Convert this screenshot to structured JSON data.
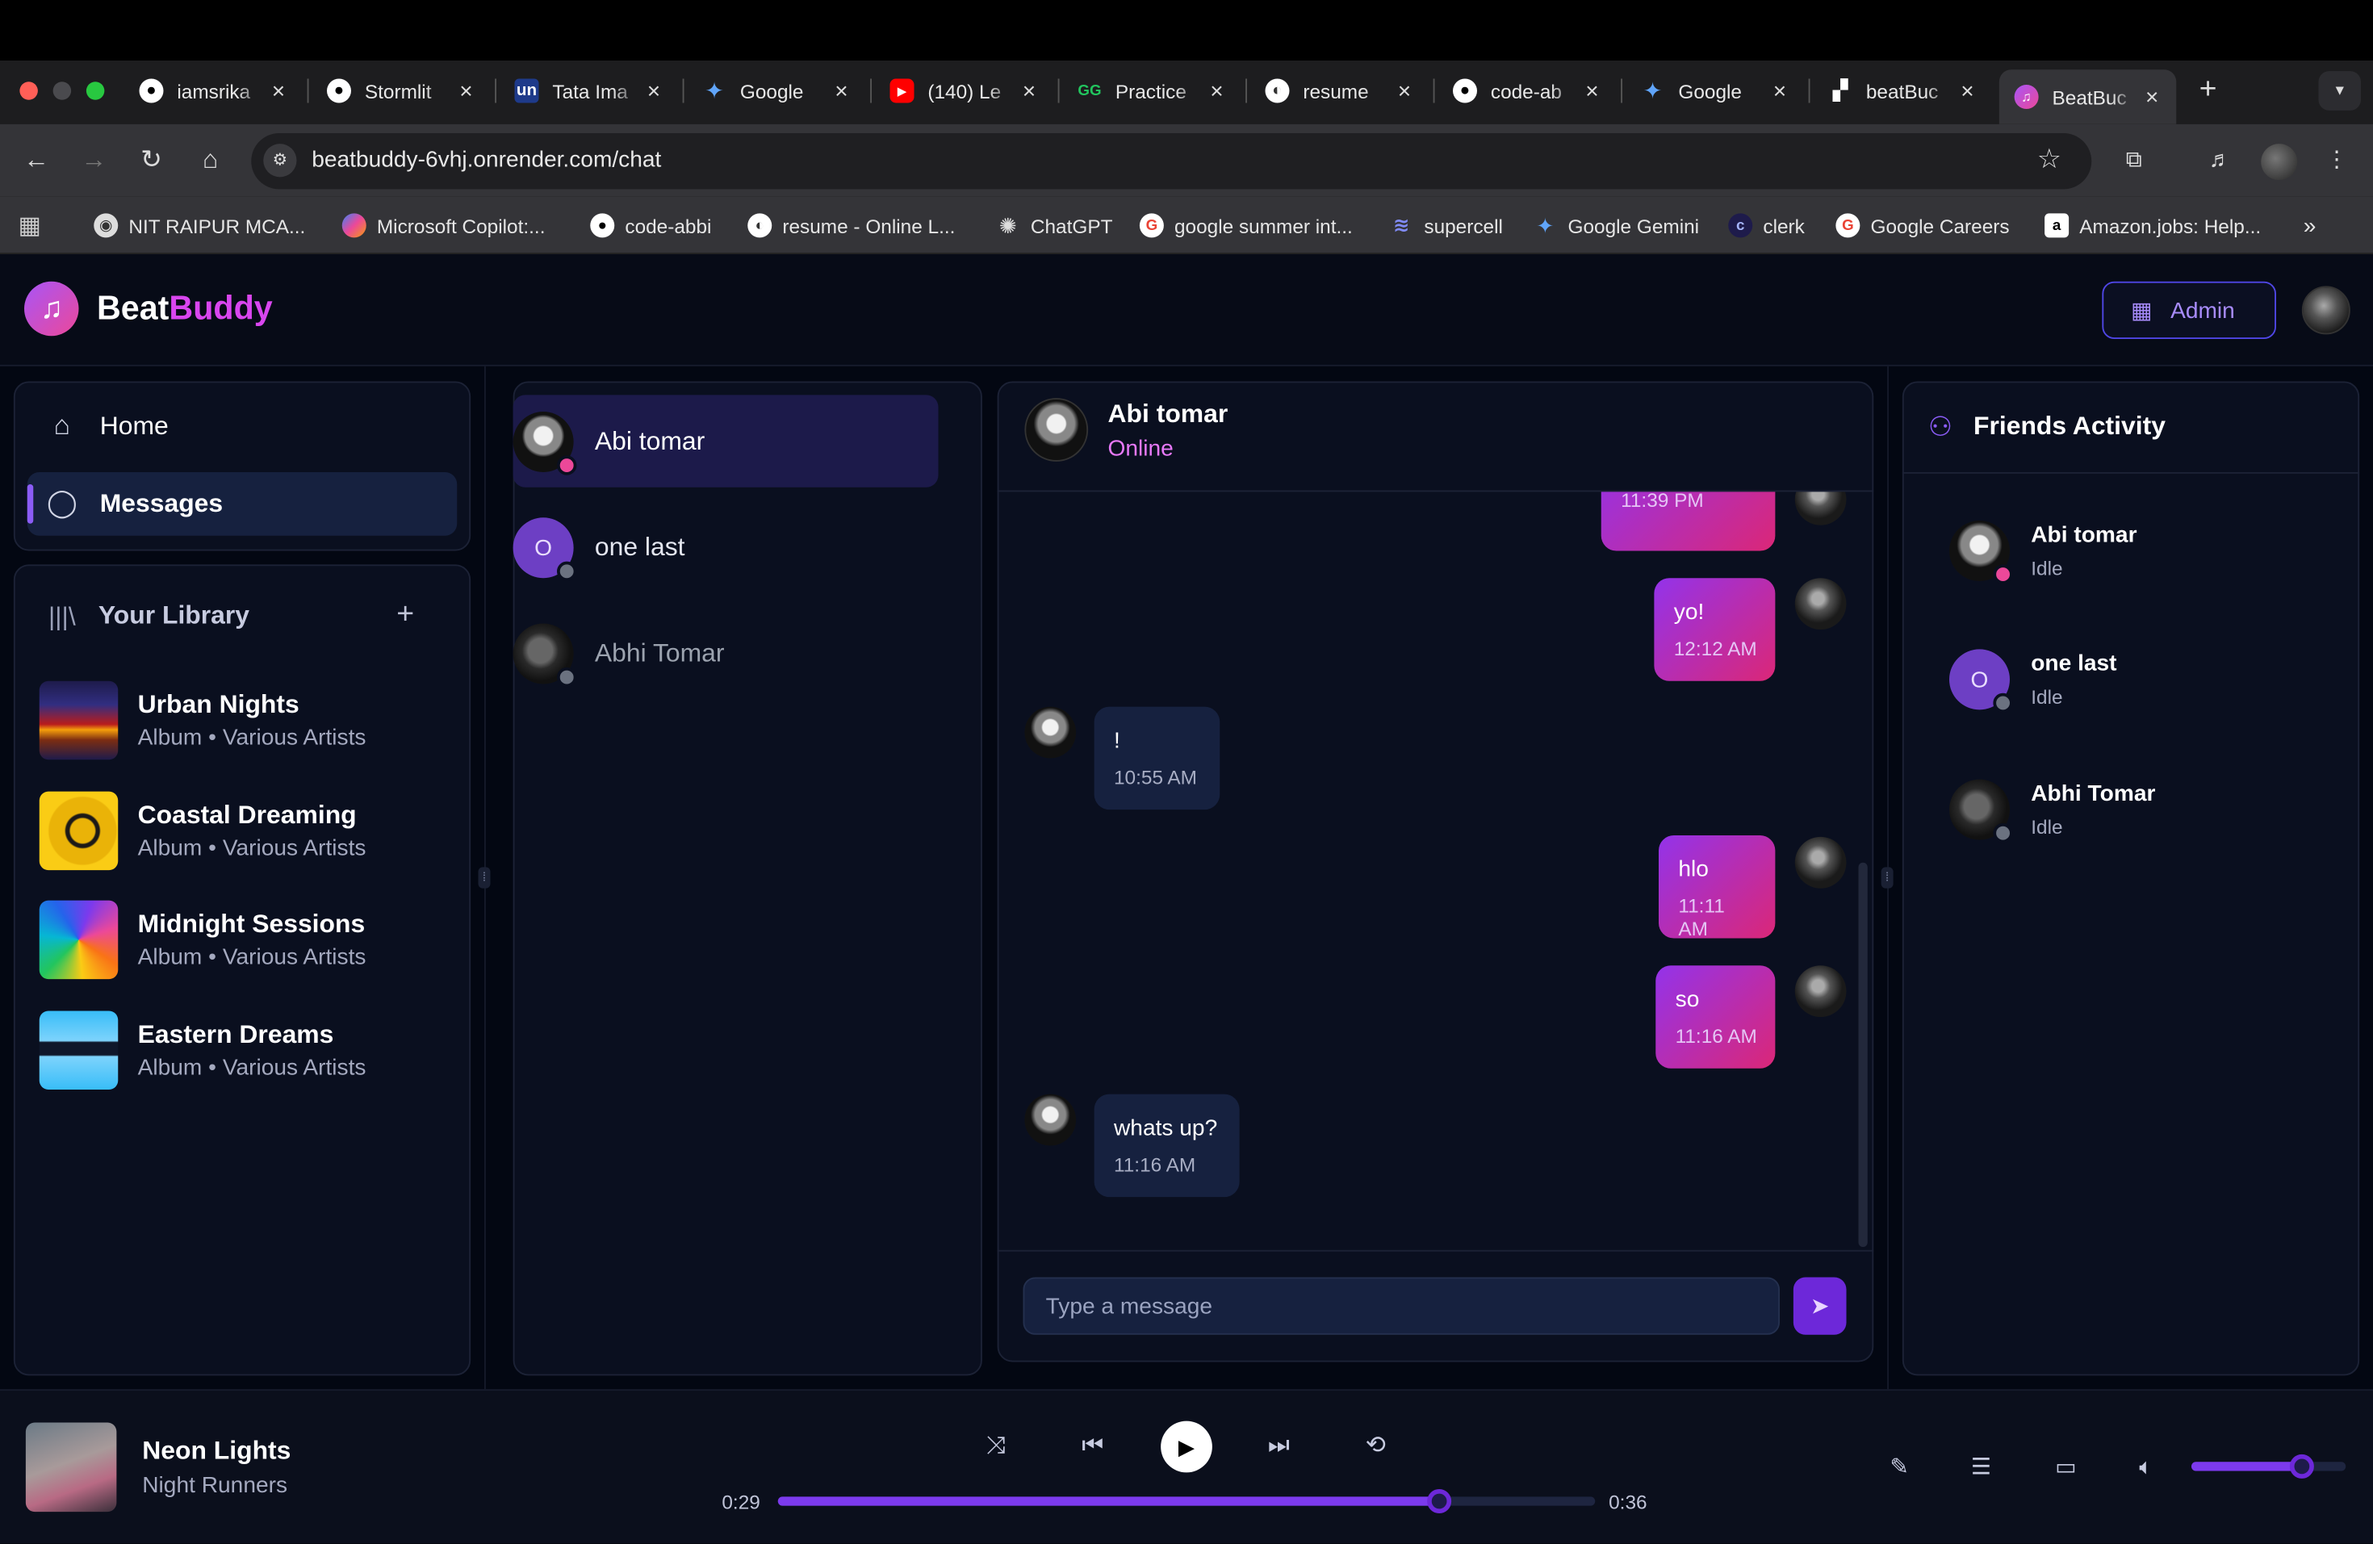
{
  "browser": {
    "tabs": [
      {
        "title": "iamsrika",
        "icon": "github-icon"
      },
      {
        "title": "Stormlit",
        "icon": "github-icon"
      },
      {
        "title": "Tata Ima",
        "icon": "unstop-icon"
      },
      {
        "title": "Google",
        "icon": "gemini-icon"
      },
      {
        "title": "(140) Le",
        "icon": "youtube-icon"
      },
      {
        "title": "Practice",
        "icon": "gfg-icon"
      },
      {
        "title": "resume",
        "icon": "overleaf-icon"
      },
      {
        "title": "code-ab",
        "icon": "github-icon"
      },
      {
        "title": "Google",
        "icon": "gemini-icon"
      },
      {
        "title": "beatBuc",
        "icon": "render-icon"
      },
      {
        "title": "BeatBuc",
        "icon": "beatbuddy-icon"
      }
    ],
    "url": "beatbuddy-6vhj.onrender.com/chat",
    "bookmarks": [
      "NIT RAIPUR MCA...",
      "Microsoft Copilot:...",
      "code-abbi",
      "resume - Online L...",
      "ChatGPT",
      "google summer int...",
      "supercell",
      "Google Gemini",
      "clerk",
      "Google Careers",
      "Amazon.jobs: Help..."
    ]
  },
  "app": {
    "brand_a": "Beat",
    "brand_b": "Buddy",
    "admin_label": "Admin",
    "accent": "#8b5cf6",
    "pink": "#d946ef"
  },
  "sidebar": {
    "nav": [
      {
        "label": "Home",
        "icon": "home-icon"
      },
      {
        "label": "Messages",
        "icon": "message-icon",
        "active": true
      }
    ],
    "library_title": "Your Library",
    "albums": [
      {
        "title": "Urban Nights",
        "subtitle": "Album • Various Artists"
      },
      {
        "title": "Coastal Dreaming",
        "subtitle": "Album • Various Artists"
      },
      {
        "title": "Midnight Sessions",
        "subtitle": "Album • Various Artists"
      },
      {
        "title": "Eastern Dreams",
        "subtitle": "Album • Various Artists"
      }
    ]
  },
  "conversations": [
    {
      "name": "Abi tomar",
      "initial": "",
      "status": "online"
    },
    {
      "name": "one last",
      "initial": "O",
      "status": "offline"
    },
    {
      "name": "Abhi Tomar",
      "initial": "",
      "status": "offline"
    }
  ],
  "chat": {
    "name": "Abi tomar",
    "status": "Online",
    "messages": [
      {
        "from": "me",
        "text": "",
        "time": "11:39 PM"
      },
      {
        "from": "me",
        "text": "yo!",
        "time": "12:12 AM"
      },
      {
        "from": "them",
        "text": "!",
        "time": "10:55 AM"
      },
      {
        "from": "me",
        "text": "hlo",
        "time": "11:11 AM"
      },
      {
        "from": "me",
        "text": "so",
        "time": "11:16 AM"
      },
      {
        "from": "them",
        "text": "whats up?",
        "time": "11:16 AM"
      }
    ],
    "input_placeholder": "Type a message"
  },
  "friends": {
    "title": "Friends Activity",
    "list": [
      {
        "name": "Abi tomar",
        "status": "Idle",
        "initial": ""
      },
      {
        "name": "one last",
        "status": "Idle",
        "initial": "O"
      },
      {
        "name": "Abhi Tomar",
        "status": "Idle",
        "initial": ""
      }
    ]
  },
  "player": {
    "title": "Neon Lights",
    "artist": "Night Runners",
    "current": "0:29",
    "duration": "0:36",
    "progress": 0.81,
    "volume": 0.72
  }
}
